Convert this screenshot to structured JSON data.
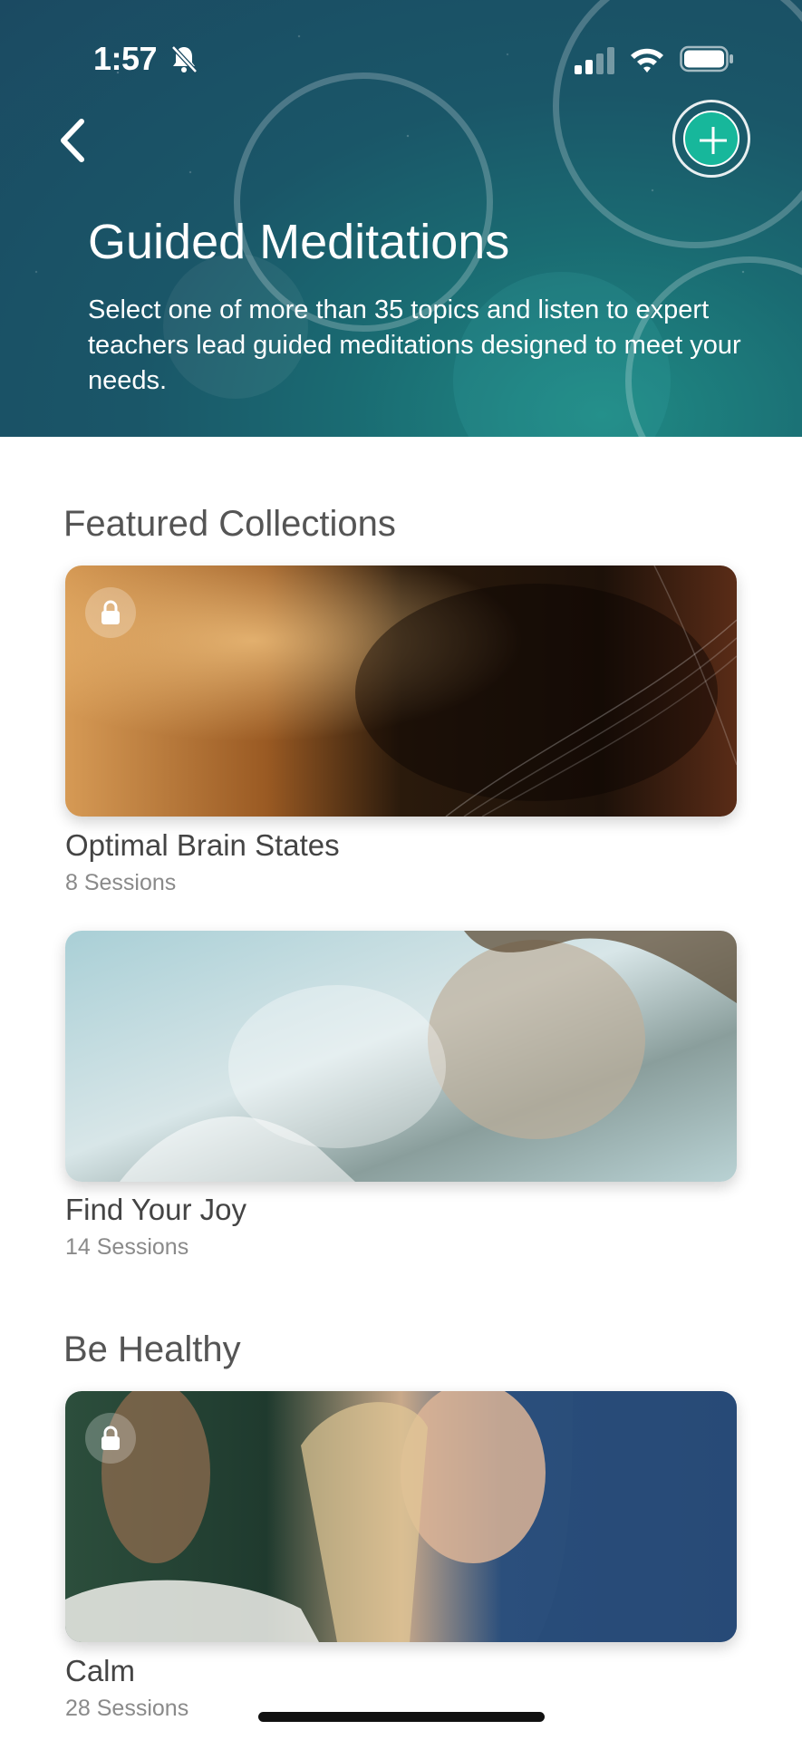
{
  "status_bar": {
    "time": "1:57"
  },
  "header": {
    "title": "Guided Meditations",
    "description": "Select one of more than 35 topics and listen to expert teachers lead guided meditations designed to meet your needs."
  },
  "sections": [
    {
      "title": "Featured Collections",
      "items": [
        {
          "title": "Optimal Brain States",
          "subtitle": "8 Sessions",
          "locked": true
        },
        {
          "title": "Find Your Joy",
          "subtitle": "14 Sessions",
          "locked": false
        }
      ]
    },
    {
      "title": "Be Healthy",
      "items": [
        {
          "title": "Calm",
          "subtitle": "28 Sessions",
          "locked": true
        }
      ]
    }
  ],
  "colors": {
    "accent": "#17b79b",
    "header_bg": "#1b4a62"
  },
  "icons": {
    "back": "chevron-left-icon",
    "add": "plus-icon",
    "lock": "lock-icon",
    "bell": "bell-slash-icon"
  }
}
